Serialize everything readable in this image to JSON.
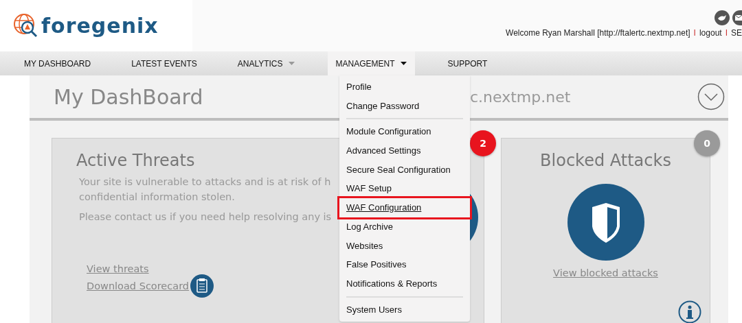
{
  "logo": {
    "text": "foregenix"
  },
  "header": {
    "welcome": "Welcome Ryan Marshall [http://ftalertc.nextmp.net]",
    "links": [
      "I",
      "logout",
      "I",
      "SE"
    ]
  },
  "nav": [
    {
      "label": "MY DASHBOARD",
      "selected": false,
      "caret": false
    },
    {
      "label": "LATEST EVENTS",
      "selected": false,
      "caret": false
    },
    {
      "label": "ANALYTICS",
      "selected": false,
      "caret": true
    },
    {
      "label": "MANAGEMENT",
      "selected": true,
      "caret": true
    },
    {
      "label": "SUPPORT",
      "selected": false,
      "caret": false
    }
  ],
  "dropdown": {
    "groups": [
      [
        {
          "label": "Profile",
          "highlighted": false
        },
        {
          "label": "Change Password",
          "highlighted": false
        }
      ],
      [
        {
          "label": "Module Configuration",
          "highlighted": false
        },
        {
          "label": "Advanced Settings",
          "highlighted": false
        },
        {
          "label": "Secure Seal Configuration",
          "highlighted": false
        },
        {
          "label": "WAF Setup",
          "highlighted": false
        },
        {
          "label": "WAF Configuration",
          "highlighted": true
        },
        {
          "label": "Log Archive",
          "highlighted": false
        },
        {
          "label": "Websites",
          "highlighted": false
        },
        {
          "label": "False Positives",
          "highlighted": false
        },
        {
          "label": "Notifications & Reports",
          "highlighted": false
        }
      ],
      [
        {
          "label": "System Users",
          "highlighted": false
        }
      ]
    ]
  },
  "page": {
    "title": "My DashBoard",
    "site": "c.nextmp.net"
  },
  "cards": [
    {
      "kind": "threats",
      "title": "Active Threats",
      "badge": "2",
      "color": "#e8141e",
      "paragraphs": [
        "Your site is vulnerable to attacks and is at risk of h",
        "confidential information stolen.",
        "Please contact us if you need help resolving any is"
      ],
      "links": [
        "View threats",
        "Download Scorecard"
      ]
    },
    {
      "kind": "blocked",
      "title": "Blocked Attacks",
      "badge": "0",
      "color": "#9a9a9a",
      "links": [
        "View blocked attacks"
      ]
    }
  ]
}
